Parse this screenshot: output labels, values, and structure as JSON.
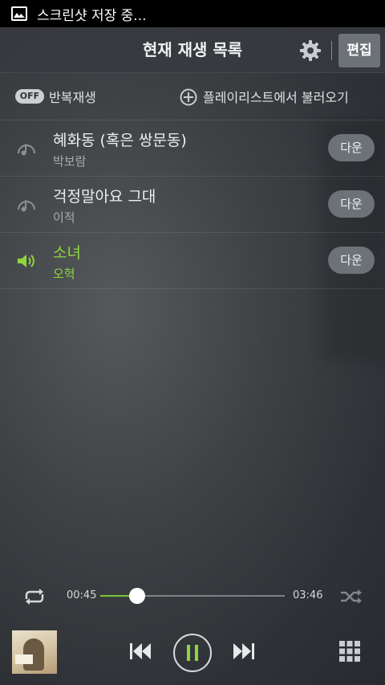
{
  "statusbar": {
    "text": "스크린샷 저장 중..."
  },
  "header": {
    "title": "현재 재생 목록",
    "edit_label": "편집"
  },
  "controls": {
    "repeat_state": "OFF",
    "repeat_label": "반복재생",
    "load_playlist_label": "플레이리스트에서 불러오기"
  },
  "tracks": [
    {
      "title": "혜화동 (혹은 쌍문동)",
      "artist": "박보람",
      "action": "다운",
      "playing": false
    },
    {
      "title": "걱정말아요 그대",
      "artist": "이적",
      "action": "다운",
      "playing": false
    },
    {
      "title": "소녀",
      "artist": "오혁",
      "action": "다운",
      "playing": true
    }
  ],
  "player": {
    "current_time": "00:45",
    "total_time": "03:46",
    "progress": 0.2
  },
  "colors": {
    "accent": "#8fd63a",
    "button_bg": "#6c7277"
  },
  "icons": {
    "settings": "gear-icon",
    "add": "plus-circle-icon",
    "repeat": "repeat-icon",
    "shuffle": "shuffle-icon",
    "prev": "skip-back-icon",
    "pause": "pause-icon",
    "next": "skip-forward-icon",
    "menu": "grid-icon"
  }
}
